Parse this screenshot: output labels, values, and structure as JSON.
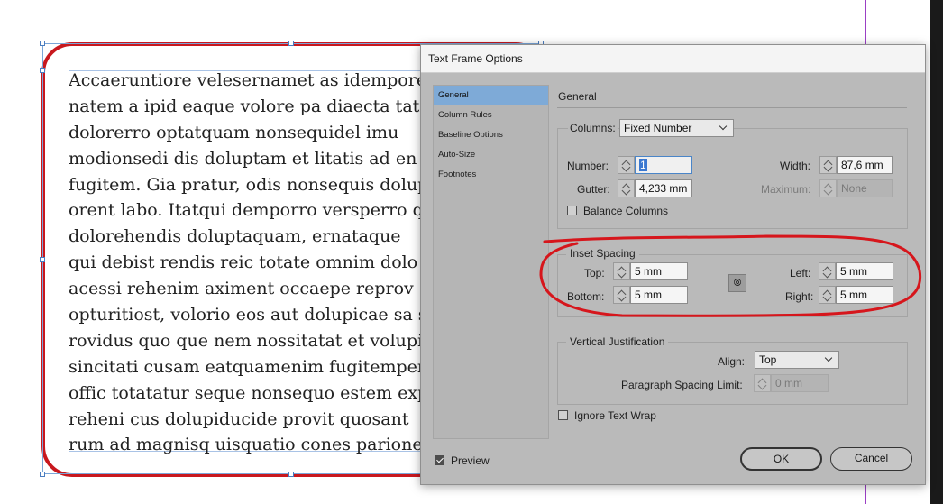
{
  "document": {
    "body_lines": [
      "Accaeruntiore velesernamet as idempore",
      "natem a ipid eaque volore pa diaecta tati",
      "dolorerro optatquam nonsequidel imu",
      "modionsedi dis doluptam et litatis ad en",
      "fugitem. Gia pratur, odis nonsequis dolup",
      "orent labo. Itatqui demporro versperro qu",
      "dolorehendis doluptaquam, ernataque",
      "qui debist rendis reic totate omnim dolo",
      "acessi rehenim aximent occaepe reprov",
      "opturitiost, volorio eos aut dolupicae sa s",
      "rovidus quo que nem nossitatat et volupis",
      "sincitati cusam eatquamenim fugitemper",
      "offic totatatur seque nonsequo estem exp",
      "reheni cus dolupiducide provit quosant",
      "rum ad magnisq uisquatio cones parione"
    ],
    "frame_outline_color": "#c8181e",
    "selection_color": "#4a7dc0"
  },
  "dialog": {
    "title": "Text Frame Options",
    "nav": [
      "General",
      "Column Rules",
      "Baseline Options",
      "Auto-Size",
      "Footnotes"
    ],
    "active_nav": "General",
    "section_title": "General",
    "columns": {
      "label": "Columns:",
      "mode": "Fixed Number",
      "number_label": "Number:",
      "number": "1",
      "gutter_label": "Gutter:",
      "gutter": "4,233 mm",
      "width_label": "Width:",
      "width": "87,6 mm",
      "maximum_label": "Maximum:",
      "maximum": "None",
      "balance_label": "Balance Columns",
      "balance_checked": false
    },
    "inset": {
      "legend": "Inset Spacing",
      "top_label": "Top:",
      "top": "5 mm",
      "bottom_label": "Bottom:",
      "bottom": "5 mm",
      "left_label": "Left:",
      "left": "5 mm",
      "right_label": "Right:",
      "right": "5 mm",
      "link_icon": "chain-link-icon"
    },
    "vertical": {
      "legend": "Vertical Justification",
      "align_label": "Align:",
      "align": "Top",
      "spacing_label": "Paragraph Spacing Limit:",
      "spacing": "0 mm"
    },
    "ignore_wrap_label": "Ignore Text Wrap",
    "ignore_wrap_checked": false,
    "preview_label": "Preview",
    "preview_checked": true,
    "ok_label": "OK",
    "cancel_label": "Cancel"
  },
  "annotation_color": "#d6161c"
}
